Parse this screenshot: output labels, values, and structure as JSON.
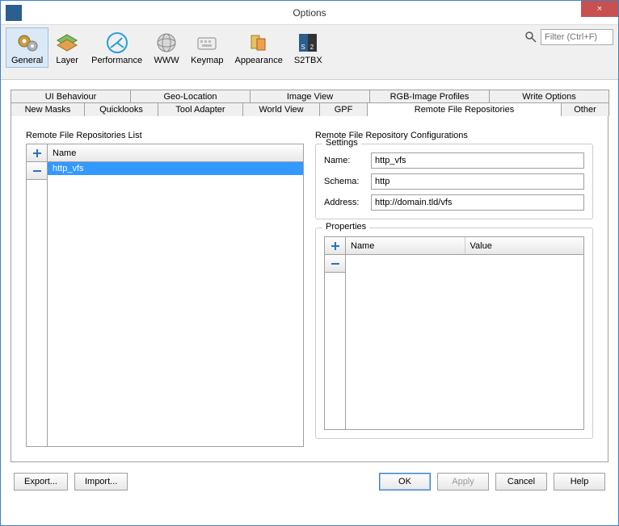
{
  "window": {
    "title": "Options",
    "close": "×"
  },
  "search": {
    "placeholder": "Filter (Ctrl+F)"
  },
  "toolbar": {
    "general": "General",
    "layer": "Layer",
    "performance": "Performance",
    "www": "WWW",
    "keymap": "Keymap",
    "appearance": "Appearance",
    "s2tbx": "S2TBX"
  },
  "tabs_row1": {
    "ui_behaviour": "UI Behaviour",
    "geo_location": "Geo-Location",
    "image_view": "Image View",
    "rgb_profiles": "RGB-Image Profiles",
    "write_options": "Write Options"
  },
  "tabs_row2": {
    "new_masks": "New Masks",
    "quicklooks": "Quicklooks",
    "tool_adapter": "Tool Adapter",
    "world_view": "World View",
    "gpf": "GPF",
    "remote_repos": "Remote File Repositories",
    "other": "Other"
  },
  "left": {
    "title": "Remote File Repositories List",
    "col_name": "Name",
    "rows": [
      {
        "name": "http_vfs"
      }
    ]
  },
  "right": {
    "title": "Remote File Repository Configurations",
    "settings_legend": "Settings",
    "name_label": "Name:",
    "name_value": "http_vfs",
    "schema_label": "Schema:",
    "schema_value": "http",
    "address_label": "Address:",
    "address_value": "http://domain.tld/vfs",
    "properties_legend": "Properties",
    "prop_name": "Name",
    "prop_value": "Value"
  },
  "footer": {
    "export": "Export...",
    "import": "Import...",
    "ok": "OK",
    "apply": "Apply",
    "cancel": "Cancel",
    "help": "Help"
  }
}
